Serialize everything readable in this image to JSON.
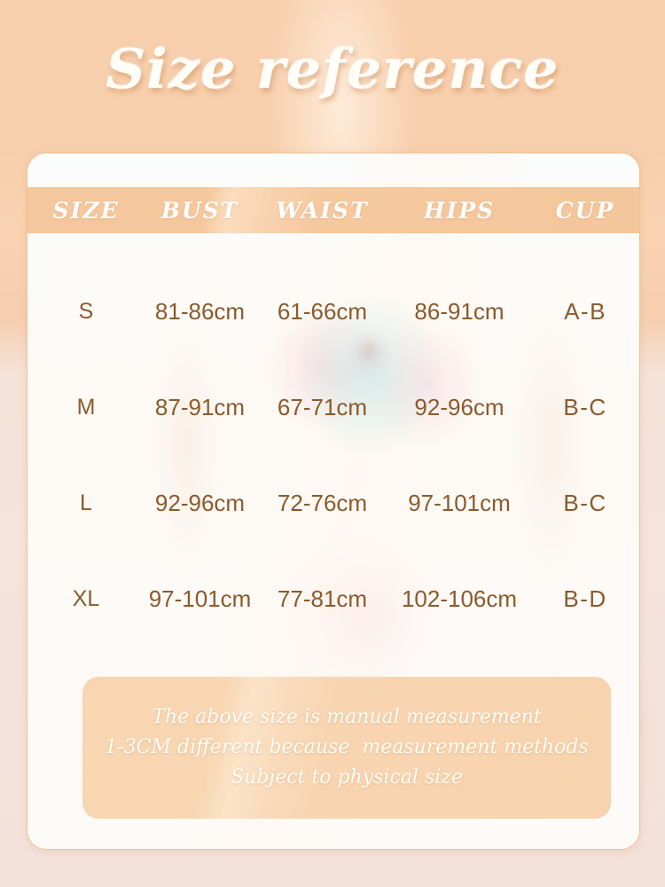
{
  "page": {
    "title": "Size reference",
    "background_color": "#f7cfac",
    "card_background": "#fdfaf6",
    "accent_color": "#f5c79c",
    "text_color": "#8c5a2b",
    "heading_text_color": "#ffffff"
  },
  "table": {
    "columns": [
      "SIZE",
      "BUST",
      "WAIST",
      "HIPS",
      "CUP"
    ],
    "rows": [
      {
        "size": "S",
        "bust": "81-86cm",
        "waist": "61-66cm",
        "hips": "86-91cm",
        "cup": "A-B"
      },
      {
        "size": "M",
        "bust": "87-91cm",
        "waist": "67-71cm",
        "hips": "92-96cm",
        "cup": "B-C"
      },
      {
        "size": "L",
        "bust": "92-96cm",
        "waist": "72-76cm",
        "hips": "97-101cm",
        "cup": "B-C"
      },
      {
        "size": "XL",
        "bust": "97-101cm",
        "waist": "77-81cm",
        "hips": "102-106cm",
        "cup": "B-D"
      }
    ]
  },
  "note": {
    "line1": "The above size is manual measurement",
    "line2": "1-3CM different because  measurement methods",
    "line3": "Subject to physical size"
  }
}
